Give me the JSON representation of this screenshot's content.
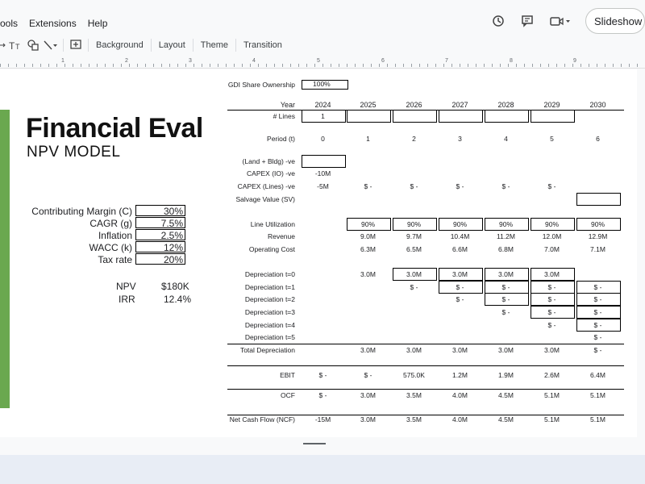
{
  "menu": [
    "ools",
    "Extensions",
    "Help"
  ],
  "slideshow_label": "Slideshow",
  "toolbar": {
    "background": "Background",
    "layout": "Layout",
    "theme": "Theme",
    "transition": "Transition"
  },
  "ruler_numbers": [
    "1",
    "2",
    "3",
    "4",
    "5",
    "6",
    "7",
    "8",
    "9"
  ],
  "slide": {
    "title": "Financial Eval",
    "subtitle": "NPV MODEL",
    "accent_color": "#6aa84f",
    "params": [
      {
        "label": "Contributing Margin (C)",
        "value": "30%"
      },
      {
        "label": "CAGR (g)",
        "value": "7.5%"
      },
      {
        "label": "Inflation",
        "value": "2.5%"
      },
      {
        "label": "WACC (k)",
        "value": "12%"
      },
      {
        "label": "Tax rate",
        "value": "20%"
      }
    ],
    "results": [
      {
        "label": "NPV",
        "value": "$180K"
      },
      {
        "label": "IRR",
        "value": "12.4%"
      }
    ],
    "gdi_label": "GDI Share Ownership",
    "gdi_value": "100%",
    "years": [
      "2024",
      "2025",
      "2026",
      "2027",
      "2028",
      "2029",
      "2030"
    ],
    "rows": [
      {
        "label": "Year",
        "values": [
          "2024",
          "2025",
          "2026",
          "2027",
          "2028",
          "2029",
          "2030"
        ]
      },
      {
        "label": "# Lines",
        "values": [
          "1",
          "",
          "",
          "",
          "",
          "",
          ""
        ]
      },
      {
        "label": "Period (t)",
        "values": [
          "0",
          "1",
          "2",
          "3",
          "4",
          "5",
          "6"
        ]
      },
      {
        "label": "(Land + Bldg) -ve",
        "values": [
          "",
          "",
          "",
          "",
          "",
          "",
          ""
        ]
      },
      {
        "label": "CAPEX (IO) -ve",
        "values": [
          "-10M",
          "",
          "",
          "",
          "",
          "",
          ""
        ]
      },
      {
        "label": "CAPEX (Lines) -ve",
        "values": [
          "-5M",
          "$ -",
          "$ -",
          "$ -",
          "$ -",
          "$ -",
          ""
        ]
      },
      {
        "label": "Salvage Value (SV)",
        "values": [
          "",
          "",
          "",
          "",
          "",
          "",
          ""
        ]
      },
      {
        "label": "Line Utilization",
        "values": [
          "",
          "90%",
          "90%",
          "90%",
          "90%",
          "90%",
          "90%"
        ]
      },
      {
        "label": "Revenue",
        "values": [
          "",
          "9.0M",
          "9.7M",
          "10.4M",
          "11.2M",
          "12.0M",
          "12.9M"
        ]
      },
      {
        "label": "Operating Cost",
        "values": [
          "",
          "6.3M",
          "6.5M",
          "6.6M",
          "6.8M",
          "7.0M",
          "7.1M"
        ]
      },
      {
        "label": "Depreciation t=0",
        "values": [
          "",
          "3.0M",
          "3.0M",
          "3.0M",
          "3.0M",
          "3.0M",
          ""
        ]
      },
      {
        "label": "Depreciation t=1",
        "values": [
          "",
          "",
          "$ -",
          "$ -",
          "$ -",
          "$ -",
          "$ -"
        ]
      },
      {
        "label": "Depreciation t=2",
        "values": [
          "",
          "",
          "",
          "$ -",
          "$ -",
          "$ -",
          "$ -"
        ]
      },
      {
        "label": "Depreciation t=3",
        "values": [
          "",
          "",
          "",
          "",
          "$ -",
          "$ -",
          "$ -"
        ]
      },
      {
        "label": "Depreciation t=4",
        "values": [
          "",
          "",
          "",
          "",
          "",
          "$ -",
          "$ -"
        ]
      },
      {
        "label": "Depreciation t=5",
        "values": [
          "",
          "",
          "",
          "",
          "",
          "",
          "$ -"
        ]
      },
      {
        "label": "Total Depreciation",
        "values": [
          "",
          "3.0M",
          "3.0M",
          "3.0M",
          "3.0M",
          "3.0M",
          "$ -"
        ]
      },
      {
        "label": "EBIT",
        "values": [
          "$ -",
          "$ -",
          "575.0K",
          "1.2M",
          "1.9M",
          "2.6M",
          "6.4M"
        ]
      },
      {
        "label": "OCF",
        "values": [
          "$ -",
          "3.0M",
          "3.5M",
          "4.0M",
          "4.5M",
          "5.1M",
          "5.1M"
        ]
      },
      {
        "label": "Net Cash Flow (NCF)",
        "values": [
          "-15M",
          "3.0M",
          "3.5M",
          "4.0M",
          "4.5M",
          "5.1M",
          "5.1M"
        ]
      }
    ]
  }
}
